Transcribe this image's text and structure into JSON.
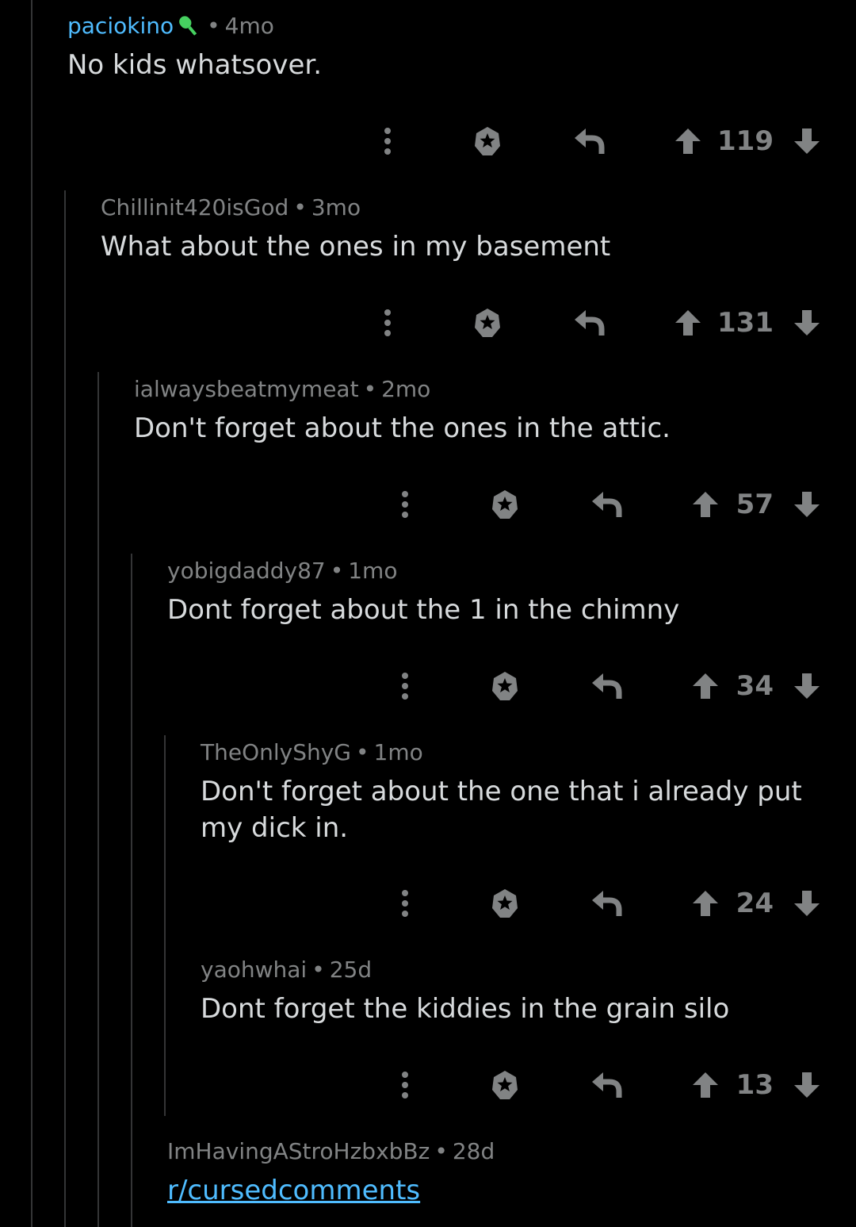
{
  "comments": [
    {
      "author": "paciokino",
      "flair_icon": "microphone-icon",
      "age": "4mo",
      "body": "No kids whatsover.",
      "score": "119"
    },
    {
      "author": "Chillinit420isGod",
      "age": "3mo",
      "body": "What about the ones in my basement",
      "score": "131"
    },
    {
      "author": "ialwaysbeatmymeat",
      "age": "2mo",
      "body": "Don't forget about the ones in the attic.",
      "score": "57"
    },
    {
      "author": "yobigdaddy87",
      "age": "1mo",
      "body": "Dont forget about the 1 in the chimny",
      "score": "34"
    },
    {
      "author": "TheOnlyShyG",
      "age": "1mo",
      "body_line1": "Don't forget about the one that i already put",
      "body_line2": "my dick in.",
      "score": "24"
    },
    {
      "author": "yaohwhai",
      "age": "25d",
      "body": "Dont forget the kiddies in the grain silo",
      "score": "13"
    },
    {
      "author": "ImHavingAStroHzbxbBz",
      "age": "28d",
      "body": "r/cursedcomments"
    }
  ],
  "separator": "•",
  "icons": [
    "more-options-icon",
    "award-icon",
    "reply-icon",
    "upvote-icon",
    "downvote-icon"
  ],
  "colors": {
    "background": "#000000",
    "op_author": "#4fbcff",
    "link": "#4fbcff",
    "meta": "#818384",
    "body": "#d7dadc",
    "thread_line": "#343536"
  }
}
